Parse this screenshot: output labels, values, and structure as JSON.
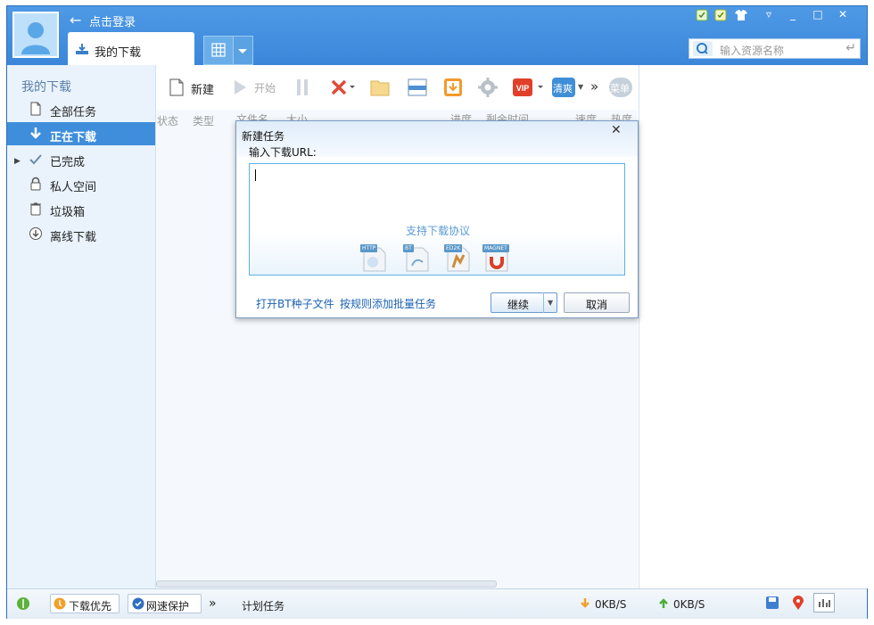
{
  "title_bar": {
    "login_label": "点击登录",
    "tab_label": "我的下载",
    "search_placeholder": "输入资源名称",
    "icons": [
      "skin-icon",
      "skin-icon",
      "shirt-icon",
      "menu-icon",
      "minimize-icon",
      "maximize-icon",
      "close-icon"
    ]
  },
  "sidebar": {
    "title": "我的下载",
    "items": [
      {
        "label": "全部任务",
        "icon": "document-icon"
      },
      {
        "label": "正在下载",
        "icon": "download-arrow-icon",
        "active": true
      },
      {
        "label": "已完成",
        "icon": "check-icon"
      },
      {
        "label": "私人空间",
        "icon": "lock-icon"
      },
      {
        "label": "垃圾箱",
        "icon": "trash-icon"
      },
      {
        "label": "离线下载",
        "icon": "cloud-download-icon"
      }
    ]
  },
  "toolbar": {
    "new_label": "新建",
    "start_label": "开始",
    "clean_label": "清爽",
    "menu_label": "菜单",
    "more_label": "»"
  },
  "columns": [
    "状态",
    "类型",
    "文件名",
    "大小",
    "进度",
    "剩余时间",
    "速度",
    "热度"
  ],
  "dialog": {
    "title": "新建任务",
    "url_label": "输入下载URL:",
    "protocols_title": "支持下载协议",
    "protocols": [
      "HTTP",
      "BT",
      "ED2K",
      "MAGNET"
    ],
    "link_bt": "打开BT种子文件",
    "link_batch": "按规则添加批量任务",
    "continue_label": "继续",
    "cancel_label": "取消"
  },
  "status_bar": {
    "priority_label": "下载优先",
    "protect_label": "网速保护",
    "more": "»",
    "schedule_label": "计划任务",
    "down_speed": "0KB/S",
    "up_speed": "0KB/S"
  },
  "colors": {
    "accent": "#3f8edb",
    "titlebar": "#4a94e2",
    "link": "#1b62b5"
  }
}
